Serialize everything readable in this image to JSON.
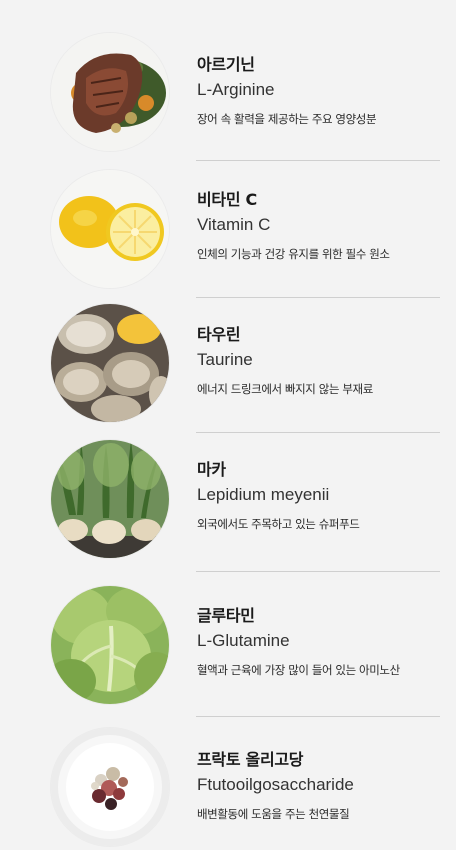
{
  "ingredients": [
    {
      "name_ko": "아르기닌",
      "name_en": "L-Arginine",
      "description": "장어 속 활력을 제공하는 주요 영양성분",
      "image": "steak-photo"
    },
    {
      "name_ko": "비타민 C",
      "name_en": "Vitamin C",
      "description": "인체의 기능과 건강 유지를 위한 필수 원소",
      "image": "lemon-photo"
    },
    {
      "name_ko": "타우린",
      "name_en": "Taurine",
      "description": "에너지 드링크에서 빠지지 않는 부재료",
      "image": "oyster-photo"
    },
    {
      "name_ko": "마카",
      "name_en": "Lepidium meyenii",
      "description": "외국에서도 주목하고 있는 슈퍼푸드",
      "image": "maca-photo"
    },
    {
      "name_ko": "글루타민",
      "name_en": "L-Glutamine",
      "description": "혈액과 근육에 가장 많이 들어 있는 아미노산",
      "image": "cabbage-photo"
    },
    {
      "name_ko": "프락토 올리고당",
      "name_en": "Ftutooilgosaccharide",
      "description": "배변활동에 도움을 주는 천연물질",
      "image": "dish-photo"
    }
  ]
}
